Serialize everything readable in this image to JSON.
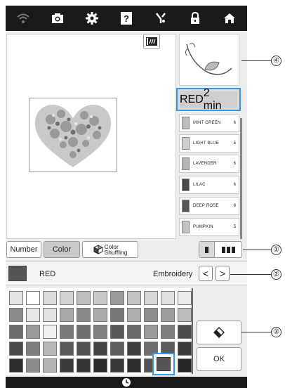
{
  "topbar": {
    "icons": [
      "wifi-icon",
      "camera-icon",
      "settings-icon",
      "help-icon",
      "embroidery-edit-icon",
      "lock-icon",
      "home-icon"
    ],
    "help_label": "?"
  },
  "threads": [
    {
      "name": "RED",
      "count": "2",
      "unit": "min",
      "color": "#5a5a5a"
    },
    {
      "name": "MINT GREEN",
      "count": "6",
      "color": "#bdbdbd"
    },
    {
      "name": "LIGHT BLUE",
      "count": "5",
      "color": "#d0d0d0"
    },
    {
      "name": "LAVENDER",
      "count": "6",
      "color": "#b5b5b5"
    },
    {
      "name": "LILAC",
      "count": "6",
      "color": "#4a4a4a"
    },
    {
      "name": "DEEP ROSE",
      "count": "8",
      "color": "#555555"
    },
    {
      "name": "PUMPKIN",
      "count": "5",
      "color": "#c2c2c2"
    }
  ],
  "tabs": {
    "number": "Number",
    "color": "Color",
    "shuffle_line1": "Color",
    "shuffle_line2": "Shuffling"
  },
  "selected": {
    "name": "RED",
    "brand": "Embroidery",
    "prev": "<",
    "next": ">",
    "color": "#555555"
  },
  "palette": [
    [
      "#e6e6e6",
      "#ffffff",
      "#dcdcdc",
      "#d4d4d4",
      "#bdbdbd",
      "#c8c8c8",
      "#9a9a9a",
      "#c4c4c4",
      "#d8d8d8",
      "#e0e0e0",
      "#ececec"
    ],
    [
      "#8c8c8c",
      "#e8e8e8",
      "#e2e2e2",
      "#a8a8a8",
      "#8a8a8a",
      "#aaaaaa",
      "#777777",
      "#b0b0b0",
      "#8e8e8e",
      "#9e9e9e",
      "#bcbcbc"
    ],
    [
      "#6c6c6c",
      "#9a9a9a",
      "#f0f0f0",
      "#7a7a7a",
      "#6e6e6e",
      "#808080",
      "#585858",
      "#6a6a6a",
      "#9c9c9c",
      "#7e7e7e",
      "#4c4c4c"
    ],
    [
      "#4a4a4a",
      "#7e7e7e",
      "#b8b8b8",
      "#5a5a5a",
      "#505050",
      "#444444",
      "#5e5e5e",
      "#3e3e3e",
      "#6e6e6e",
      "#5c5c5c",
      "#3a3a3a"
    ],
    [
      "#2e2e2e",
      "#8c8c8c",
      "#b4b4b4",
      "#3a3a3a",
      "#343434",
      "#2a2a2a",
      "#383838",
      "#2c2c2c",
      "#555555",
      "#323232",
      "#262626"
    ]
  ],
  "actions": {
    "ok": "OK"
  },
  "callouts": [
    "①",
    "②",
    "③",
    "④"
  ]
}
